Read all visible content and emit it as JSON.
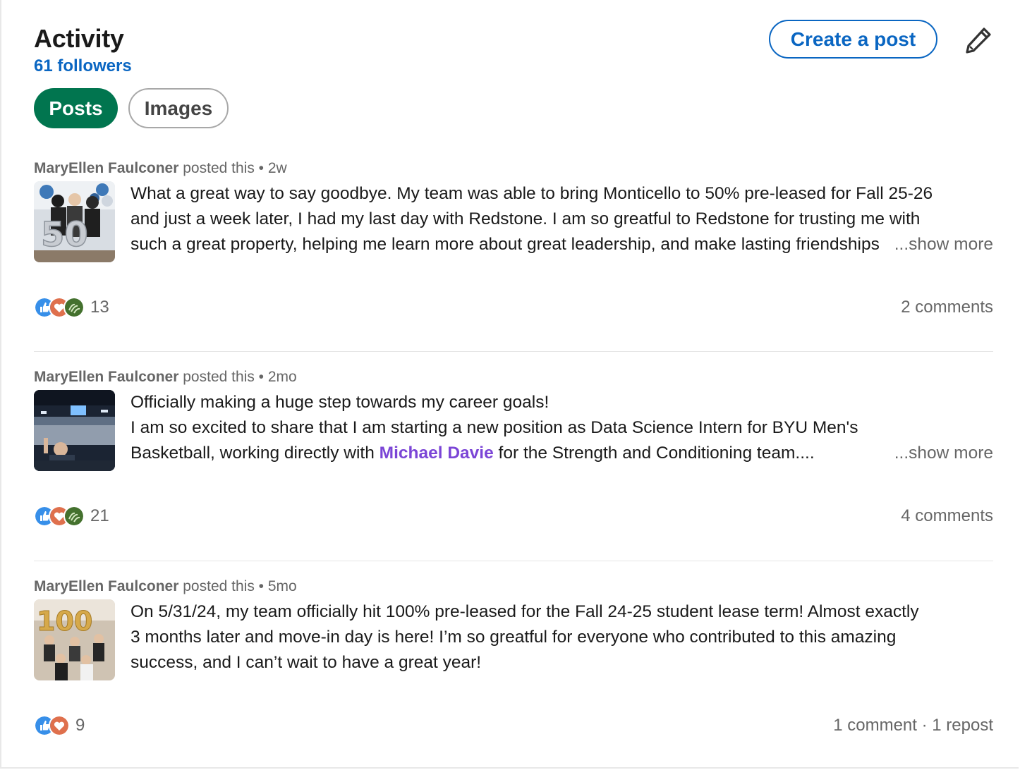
{
  "header": {
    "title": "Activity",
    "followers": "61 followers",
    "create_post_label": "Create a post",
    "edit_icon": "pencil-icon"
  },
  "tabs": [
    {
      "label": "Posts",
      "active": true
    },
    {
      "label": "Images",
      "active": false
    }
  ],
  "colors": {
    "accent_blue": "#0a66c2",
    "active_tab_green": "#01754f",
    "mention_purple": "#7b45d6"
  },
  "posts": [
    {
      "author": "MaryEllen Faulconer",
      "action": "posted this",
      "separator": "•",
      "age": "2w",
      "image_icon": "balloons-50-photo",
      "lines": [
        "What a great way to say goodbye. My team was able to bring Monticello to 50% pre-leased for Fall 25-26",
        "and just a week later, I had my last day with Redstone. I am so greatful to Redstone for trusting me with",
        "such a great property, helping me learn more about great leadership, and make lasting friendships"
      ],
      "show_more": "...show more",
      "reaction_icons": [
        "like-icon",
        "love-icon",
        "support-icon"
      ],
      "reaction_count": "13",
      "comments": "2 comments"
    },
    {
      "author": "MaryEllen Faulconer",
      "action": "posted this",
      "separator": "•",
      "age": "2mo",
      "image_icon": "arena-photo",
      "line1": "Officially making a huge step towards my career goals!",
      "line2": "I am so excited to share that I am starting a new position as Data Science Intern for BYU Men's",
      "line3_before": "Basketball, working directly with ",
      "mention": "Michael Davie",
      "line3_after": " for the Strength and Conditioning team....",
      "show_more": "...show more",
      "reaction_icons": [
        "like-icon",
        "love-icon",
        "support-icon"
      ],
      "reaction_count": "21",
      "comments": "4 comments"
    },
    {
      "author": "MaryEllen Faulconer",
      "action": "posted this",
      "separator": "•",
      "age": "5mo",
      "image_icon": "balloons-100-photo",
      "lines": [
        "On 5/31/24, my team officially hit 100% pre-leased for the Fall 24-25 student lease term! Almost exactly",
        "3 months later and move-in day is here! I’m so greatful for everyone who contributed to this amazing",
        "success, and I can’t wait to have a great year!"
      ],
      "reaction_icons": [
        "like-icon",
        "love-icon"
      ],
      "reaction_count": "9",
      "comments": "1 comment",
      "repost_separator": "·",
      "reposts": "1 repost"
    }
  ]
}
